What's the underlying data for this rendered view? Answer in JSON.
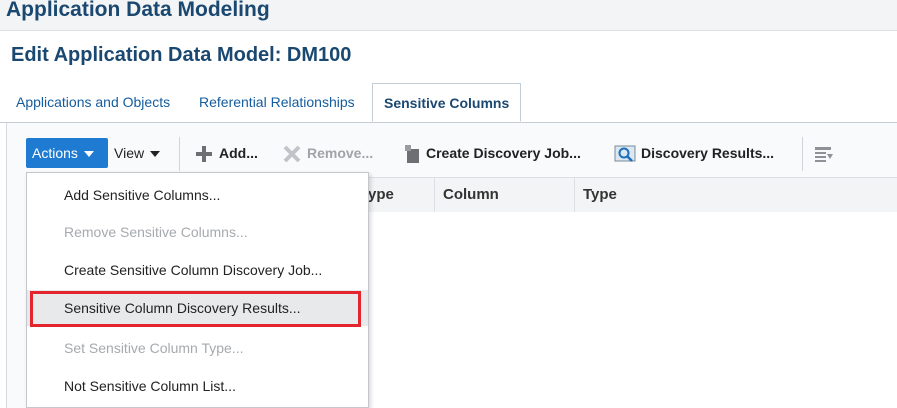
{
  "app": {
    "title": "Application Data Modeling"
  },
  "page": {
    "title": "Edit Application Data Model: DM100"
  },
  "tabs": [
    {
      "label": "Applications and Objects",
      "active": false
    },
    {
      "label": "Referential Relationships",
      "active": false
    },
    {
      "label": "Sensitive Columns",
      "active": true
    }
  ],
  "toolbar": {
    "actions_label": "Actions",
    "view_label": "View",
    "add_label": "Add...",
    "remove_label": "Remove...",
    "create_job_label": "Create Discovery Job...",
    "discovery_results_label": "Discovery Results..."
  },
  "table": {
    "columns": [
      "ype",
      "Column",
      "Type"
    ]
  },
  "menu": {
    "items": [
      {
        "label": "Add Sensitive Columns...",
        "enabled": true
      },
      {
        "label": "Remove Sensitive Columns...",
        "enabled": false
      },
      {
        "label": "Create Sensitive Column Discovery Job...",
        "enabled": true
      },
      {
        "label": "Sensitive Column Discovery Results...",
        "enabled": true,
        "highlighted": true
      },
      {
        "label": "Set Sensitive Column Type...",
        "enabled": false
      },
      {
        "label": "Not Sensitive Column List...",
        "enabled": true
      }
    ]
  },
  "colors": {
    "accent": "#1f7bd1",
    "title": "#1a4870",
    "link": "#145c9e",
    "highlight_border": "#e3252d"
  }
}
